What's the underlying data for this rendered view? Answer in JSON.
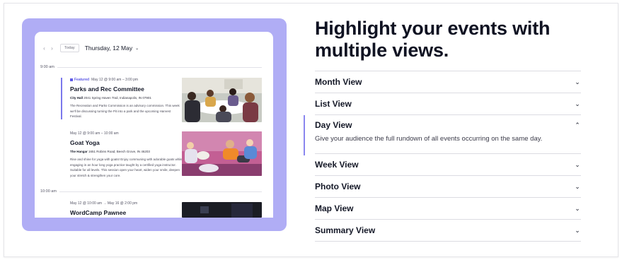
{
  "preview": {
    "nav": {
      "prev_icon": "chevron-left-icon",
      "next_icon": "chevron-right-icon",
      "today_label": "Today",
      "date_label": "Thursday, 12 May"
    },
    "time_labels": [
      "9:00 am",
      "10:00 am"
    ],
    "events": [
      {
        "flag": "Featured",
        "meta": "May 12 @ 9:00 am – 3:00 pm",
        "title": "Parks and Rec Committee",
        "venue_name": "City Hall",
        "venue_address": "2041 Spring Haven Trail, Indianapolis, IN 07901",
        "description": "The Recreation and Parks Commission is an advisory commission. This week we'll be discussing turning the Pit into a park and the upcoming Harvest Festival."
      },
      {
        "meta": "May 12 @ 9:00 am – 10:00 am",
        "title": "Goat Yoga",
        "venue_name": "The Hangar",
        "venue_address": "1651 Robins Road, Beech Grove, IN 46203",
        "description": "Rise and shine for yoga with goats! Enjoy communing with adorable goats while engaging in an hour long yoga practice taught by a certified yoga instructor. Suitable for all levels. This session open your heart, widen your smile, deepen your stretch & strengthen your core."
      },
      {
        "meta": "May 12 @ 10:00 am → May 16 @ 2:00 pm",
        "title": "WordCamp Pawnee"
      }
    ],
    "colors": {
      "panel": "#b0adf5",
      "accent": "#5f5be6"
    }
  },
  "heading": "Highlight your events with multiple views.",
  "accordion": [
    {
      "label": "Month View",
      "open": false
    },
    {
      "label": "List View",
      "open": false
    },
    {
      "label": "Day View",
      "open": true,
      "body": "Give your audience the full rundown of all events occurring on the same day."
    },
    {
      "label": "Week View",
      "open": false
    },
    {
      "label": "Photo View",
      "open": false
    },
    {
      "label": "Map View",
      "open": false
    },
    {
      "label": "Summary View",
      "open": false
    }
  ],
  "icons": {
    "collapsed": "chevron-down-icon",
    "expanded": "chevron-up-icon"
  }
}
